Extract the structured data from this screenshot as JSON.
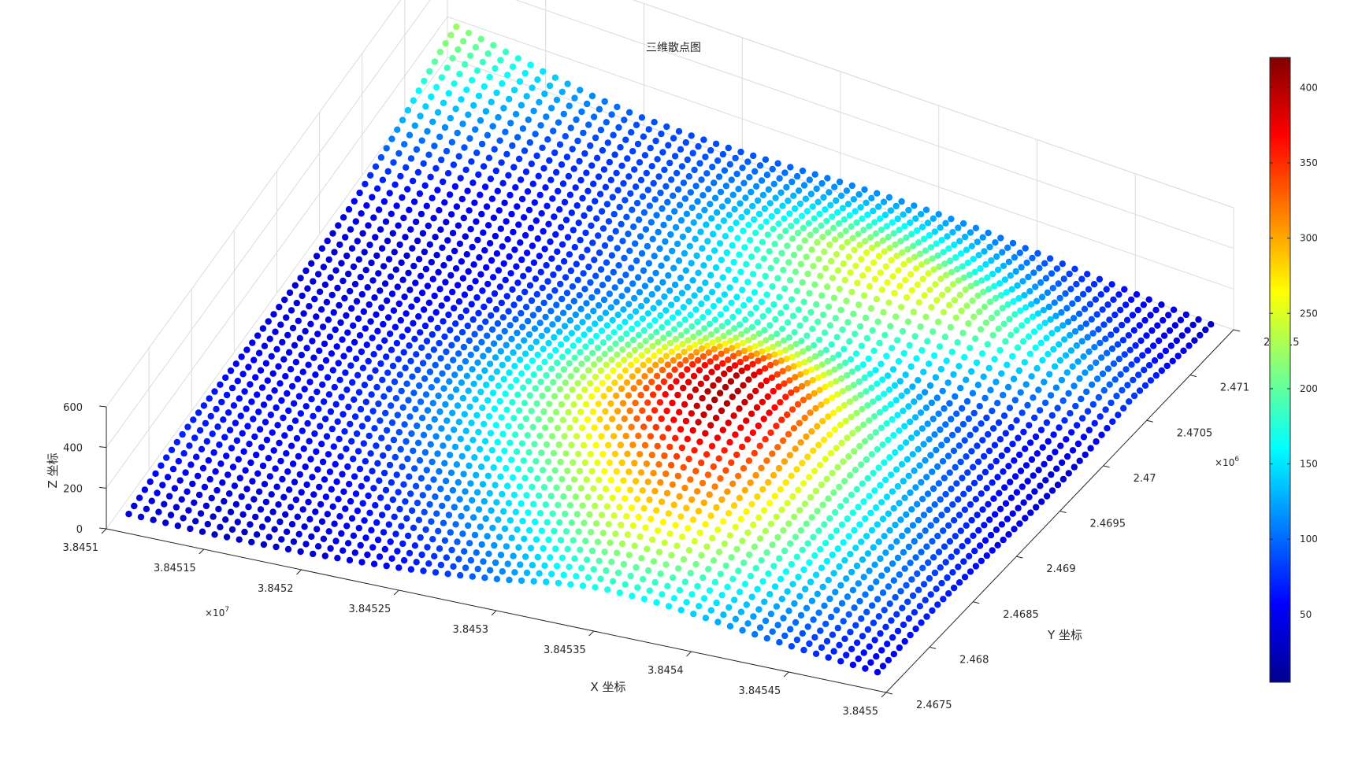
{
  "chart_data": {
    "type": "scatter3d",
    "title": "三维散点图",
    "xlabel": "X 坐标",
    "ylabel": "Y 坐标",
    "zlabel": "Z 坐标",
    "colormap": "jet",
    "grid": true,
    "colorbar_position": "right",
    "x_exponent": "×10^7",
    "y_exponent": "×10^6",
    "xlim": [
      38451000,
      38455000
    ],
    "ylim": [
      2467500,
      2471500
    ],
    "zlim": [
      0,
      600
    ],
    "clim": [
      5,
      420
    ],
    "x_ticks": [
      {
        "value": 38451000,
        "label": "3.8451"
      },
      {
        "value": 38451500,
        "label": "3.84515"
      },
      {
        "value": 38452000,
        "label": "3.8452"
      },
      {
        "value": 38452500,
        "label": "3.84525"
      },
      {
        "value": 38453000,
        "label": "3.8453"
      },
      {
        "value": 38453500,
        "label": "3.84535"
      },
      {
        "value": 38454000,
        "label": "3.8454"
      },
      {
        "value": 38454500,
        "label": "3.84545"
      },
      {
        "value": 38455000,
        "label": "3.8455"
      }
    ],
    "y_ticks": [
      {
        "value": 2467500,
        "label": "2.4675"
      },
      {
        "value": 2468000,
        "label": "2.468"
      },
      {
        "value": 2468500,
        "label": "2.4685"
      },
      {
        "value": 2469000,
        "label": "2.469"
      },
      {
        "value": 2469500,
        "label": "2.4695"
      },
      {
        "value": 2470000,
        "label": "2.47"
      },
      {
        "value": 2470500,
        "label": "2.4705"
      },
      {
        "value": 2471000,
        "label": "2.471"
      },
      {
        "value": 2471500,
        "label": "2.4715"
      }
    ],
    "z_ticks": [
      {
        "value": 0,
        "label": "0"
      },
      {
        "value": 200,
        "label": "200"
      },
      {
        "value": 400,
        "label": "400"
      },
      {
        "value": 600,
        "label": "600"
      }
    ],
    "colorbar_ticks": [
      {
        "value": 50,
        "label": "50"
      },
      {
        "value": 100,
        "label": "100"
      },
      {
        "value": 150,
        "label": "150"
      },
      {
        "value": 200,
        "label": "200"
      },
      {
        "value": 250,
        "label": "250"
      },
      {
        "value": 300,
        "label": "300"
      },
      {
        "value": 350,
        "label": "350"
      },
      {
        "value": 400,
        "label": "400"
      }
    ],
    "surface_grid": [
      [
        40,
        35,
        30,
        30,
        35,
        45,
        60,
        80,
        105,
        140,
        160,
        150,
        130,
        105,
        80,
        60,
        40
      ],
      [
        55,
        45,
        35,
        40,
        45,
        55,
        70,
        95,
        125,
        170,
        200,
        190,
        160,
        120,
        90,
        65,
        45
      ],
      [
        70,
        55,
        45,
        45,
        55,
        70,
        95,
        125,
        165,
        215,
        255,
        250,
        200,
        150,
        110,
        80,
        55
      ],
      [
        75,
        65,
        55,
        55,
        65,
        85,
        115,
        155,
        205,
        255,
        300,
        295,
        240,
        175,
        125,
        90,
        60
      ],
      [
        70,
        60,
        60,
        65,
        80,
        110,
        145,
        190,
        240,
        300,
        345,
        330,
        260,
        180,
        130,
        90,
        55
      ],
      [
        60,
        55,
        60,
        70,
        95,
        130,
        170,
        220,
        285,
        350,
        390,
        360,
        270,
        180,
        125,
        80,
        50
      ],
      [
        50,
        50,
        60,
        75,
        100,
        140,
        185,
        240,
        310,
        380,
        410,
        370,
        270,
        170,
        110,
        70,
        40
      ],
      [
        45,
        45,
        55,
        70,
        95,
        135,
        180,
        235,
        300,
        370,
        400,
        350,
        250,
        155,
        95,
        60,
        35
      ],
      [
        40,
        45,
        50,
        60,
        85,
        120,
        160,
        205,
        260,
        320,
        340,
        290,
        210,
        135,
        85,
        55,
        30
      ],
      [
        40,
        40,
        45,
        55,
        70,
        100,
        135,
        170,
        205,
        245,
        250,
        220,
        165,
        110,
        75,
        50,
        30
      ],
      [
        45,
        40,
        40,
        50,
        65,
        85,
        110,
        140,
        165,
        185,
        185,
        165,
        130,
        95,
        75,
        55,
        40
      ],
      [
        60,
        50,
        45,
        50,
        60,
        80,
        100,
        125,
        150,
        175,
        200,
        195,
        170,
        140,
        110,
        80,
        55
      ],
      [
        90,
        70,
        55,
        55,
        65,
        85,
        110,
        140,
        175,
        215,
        250,
        260,
        240,
        200,
        150,
        105,
        70
      ],
      [
        130,
        100,
        75,
        65,
        70,
        90,
        115,
        150,
        190,
        230,
        255,
        250,
        220,
        175,
        130,
        90,
        60
      ],
      [
        180,
        140,
        105,
        80,
        75,
        85,
        105,
        130,
        160,
        190,
        200,
        185,
        155,
        120,
        90,
        65,
        45
      ],
      [
        225,
        185,
        140,
        105,
        85,
        85,
        95,
        110,
        125,
        140,
        145,
        135,
        115,
        90,
        70,
        50,
        35
      ],
      [
        240,
        205,
        160,
        120,
        95,
        85,
        85,
        90,
        100,
        105,
        105,
        100,
        85,
        70,
        55,
        40,
        30
      ]
    ]
  }
}
